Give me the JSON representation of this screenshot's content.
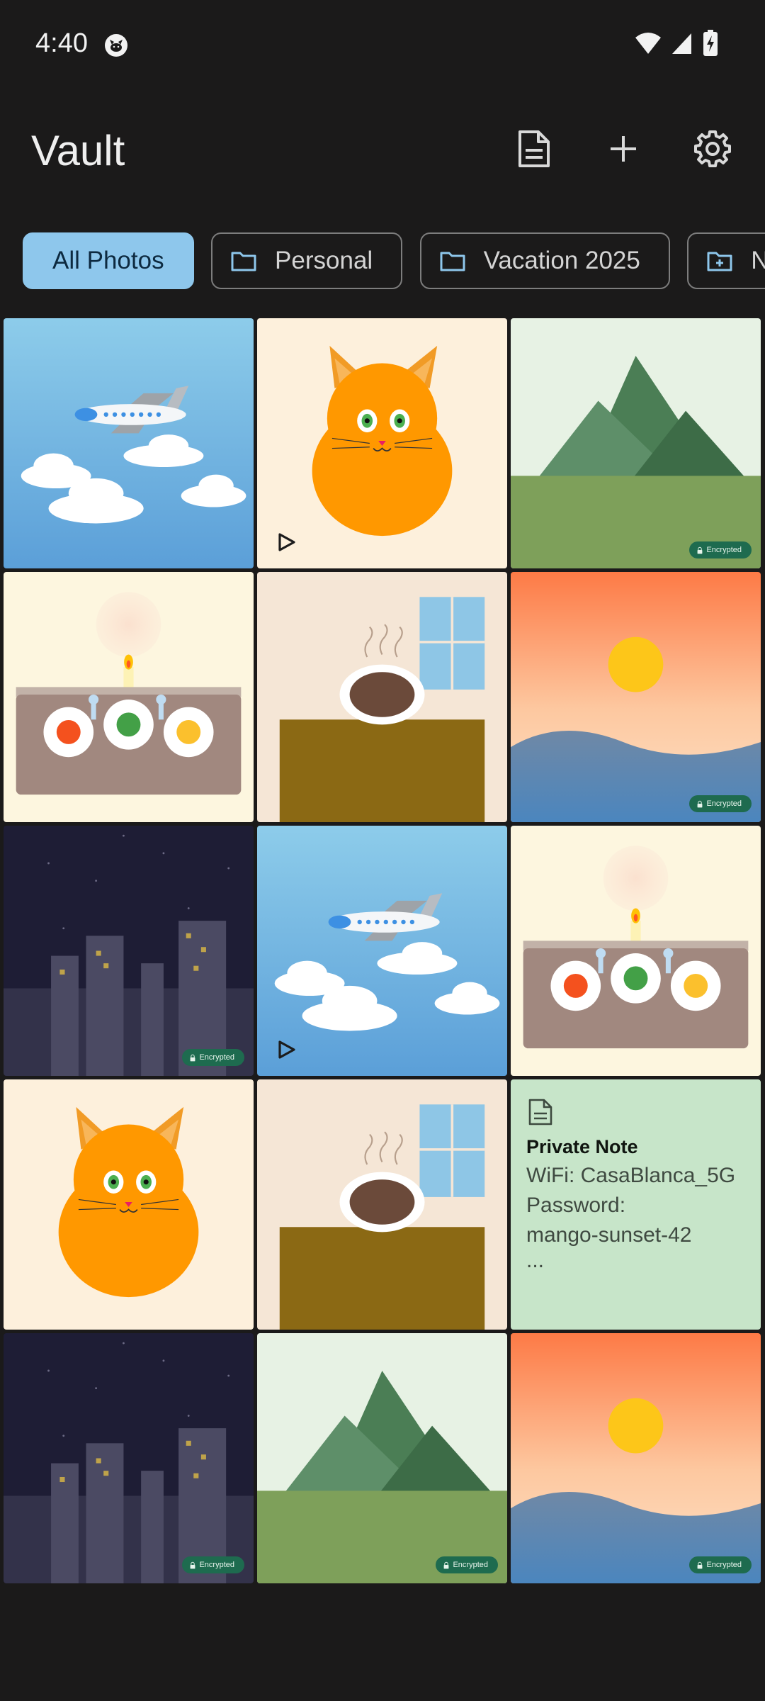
{
  "status_bar": {
    "time": "4:40"
  },
  "app_bar": {
    "title": "Vault",
    "actions": [
      "note-icon",
      "plus-icon",
      "gear-icon"
    ]
  },
  "chips": [
    {
      "label": "All Photos",
      "selected": true
    },
    {
      "label": "Personal",
      "icon": "folder-icon"
    },
    {
      "label": "Vacation 2025",
      "icon": "folder-icon"
    },
    {
      "label": "N",
      "icon": "new-folder-icon"
    }
  ],
  "badges": {
    "encrypted": "Encrypted"
  },
  "note": {
    "title": "Private Note",
    "line1": "WiFi: CasaBlanca_5G",
    "line2": "Password:",
    "line3": "mango-sunset-42",
    "ellipsis": "..."
  },
  "colors": {
    "background": "#1b1a1a",
    "chip_selected": "#8ec7ec",
    "badge": "#1e6b4f",
    "note_bg": "#c7e5c9"
  }
}
